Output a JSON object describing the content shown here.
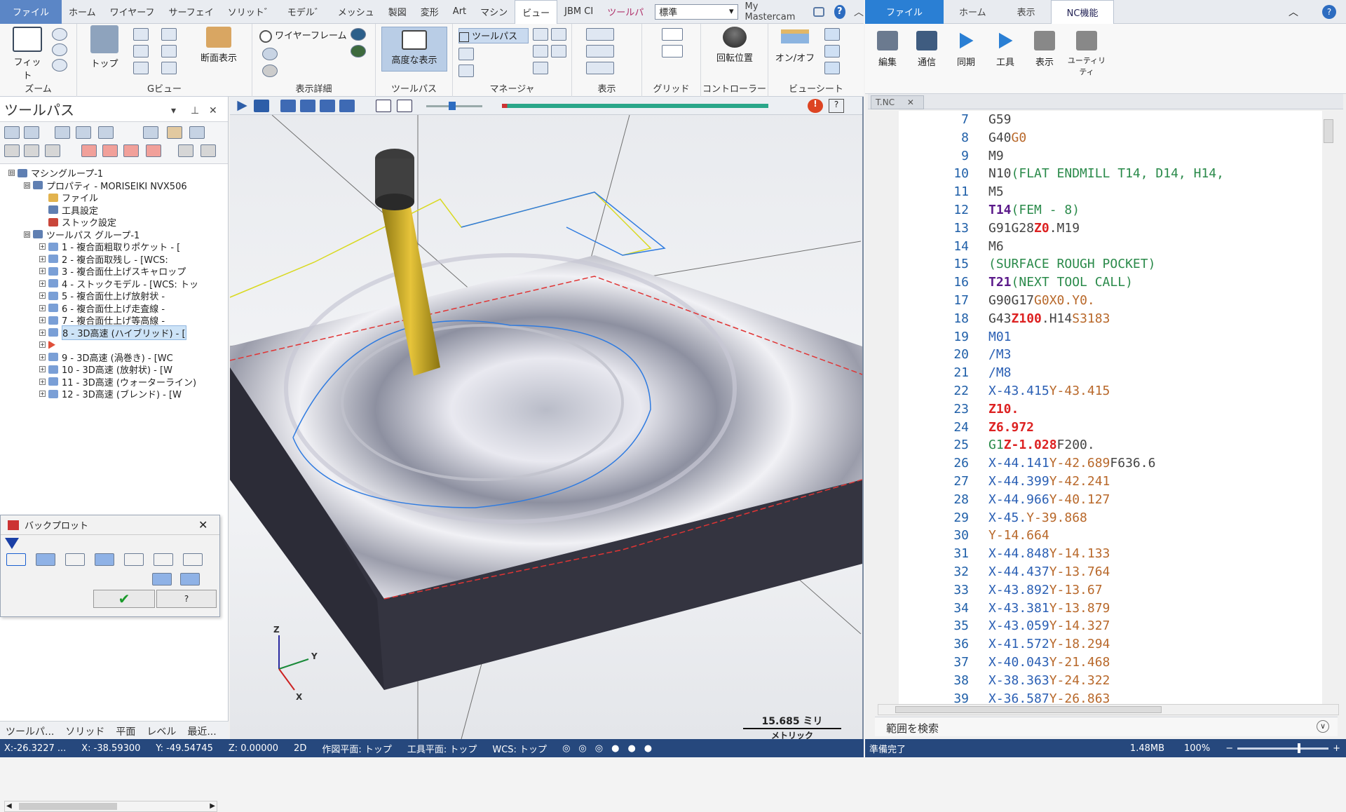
{
  "mastercam": {
    "tabs": [
      "ファイル",
      "ホーム",
      "ワイヤーフ",
      "サーフェイ",
      "ソリット゛",
      "モデル゛",
      "メッシュ",
      "製図",
      "変形",
      "Art",
      "マシン",
      "ビュー",
      "JBM CI",
      "ツールパ"
    ],
    "style_select": "標準",
    "my_mastercam": "My Mastercam",
    "ribbon": {
      "fit": "フィット",
      "zoom_group": "ズーム",
      "top": "トップ",
      "gview_group": "Gビュー",
      "section": "断面表示",
      "wireframe": "ワイヤーフレーム",
      "display_detail_group": "表示詳細",
      "advanced": "高度な表示",
      "toolpath_group": "ツールパス",
      "toolpath_btn": "ツールパス",
      "manager_group": "マネージャ",
      "display_group": "表示",
      "grid_group": "グリッド",
      "rotation": "回転位置",
      "controller_group": "コントローラー",
      "onoff": "オン/オフ",
      "viewsheet_group": "ビューシート"
    },
    "toolpath_panel": {
      "title": "ツールパス",
      "tree": [
        {
          "label": "マシングループ-1",
          "level": 0
        },
        {
          "label": "プロパティ - MORISEIKI NVX506",
          "level": 1
        },
        {
          "label": "ファイル",
          "level": 2
        },
        {
          "label": "工具設定",
          "level": 2
        },
        {
          "label": "ストック設定",
          "level": 2
        },
        {
          "label": "ツールパス グループ-1",
          "level": 1
        },
        {
          "label": "1 - 複合面粗取りポケット - [",
          "level": 2
        },
        {
          "label": "2 - 複合面取残し - [WCS:",
          "level": 2
        },
        {
          "label": "3 - 複合面仕上げスキャロップ",
          "level": 2
        },
        {
          "label": "4 - ストックモデル - [WCS: トッ",
          "level": 2
        },
        {
          "label": "5 - 複合面仕上げ放射状 -",
          "level": 2
        },
        {
          "label": "6 - 複合面仕上げ走査線 -",
          "level": 2
        },
        {
          "label": "7 - 複合面仕上げ等高線 -",
          "level": 2
        },
        {
          "label": "8 - 3D高速 (ハイブリッド) - [",
          "level": 2,
          "selected": true
        },
        {
          "label": "",
          "level": 2,
          "marker": true
        },
        {
          "label": "9 - 3D高速 (渦巻き) - [WC",
          "level": 2
        },
        {
          "label": "10 - 3D高速 (放射状) - [W",
          "level": 2
        },
        {
          "label": "11 - 3D高速 (ウォーターライン)",
          "level": 2
        },
        {
          "label": "12 - 3D高速 (ブレンド) - [W",
          "level": 2
        }
      ],
      "bottom_tabs": [
        "ツールパ...",
        "ソリッド",
        "平面",
        "レベル",
        "最近..."
      ]
    },
    "backplot_title": "バックプロット",
    "scale_value": "15.685 ミリ",
    "scale_unit": "メトリック",
    "axes": {
      "x": "X",
      "y": "Y",
      "z": "Z"
    },
    "status": {
      "coord": "X:-26.3227 ...",
      "x": "X: -38.59300",
      "y": "Y: -49.54745",
      "z": "Z: 0.00000",
      "mode": "2D",
      "cplane": "作図平面: トップ",
      "tplane": "工具平面: トップ",
      "wcs": "WCS: トップ"
    }
  },
  "nc_editor": {
    "tabs": [
      "ファイル",
      "ホーム",
      "表示",
      "NC機能"
    ],
    "buttons": [
      "編集",
      "通信",
      "同期",
      "工具",
      "表示",
      "ユーティリティ"
    ],
    "file_tab": "T.NC",
    "search_placeholder": "範囲を検索",
    "status_left": "準備完了",
    "status_size": "1.48MB",
    "status_zoom": "100%",
    "lines": [
      {
        "n": "7",
        "segs": [
          [
            "G59",
            "g"
          ]
        ]
      },
      {
        "n": "8",
        "segs": [
          [
            "G40",
            "g"
          ],
          [
            "G0",
            "ora"
          ]
        ]
      },
      {
        "n": "9",
        "segs": [
          [
            "M9",
            "g"
          ]
        ]
      },
      {
        "n": "10",
        "segs": [
          [
            "N10",
            "g"
          ],
          [
            "(FLAT ENDMILL T14, D14, H14,",
            "green"
          ]
        ]
      },
      {
        "n": "11",
        "segs": [
          [
            "M5",
            "g"
          ]
        ]
      },
      {
        "n": "12",
        "segs": [
          [
            "T14",
            "pur"
          ],
          [
            "(FEM - 8)",
            "green"
          ]
        ]
      },
      {
        "n": "13",
        "segs": [
          [
            "G91G28",
            "g"
          ],
          [
            "Z0",
            "red"
          ],
          [
            ".M19",
            "g"
          ]
        ]
      },
      {
        "n": "14",
        "segs": [
          [
            "M6",
            "g"
          ]
        ]
      },
      {
        "n": "15",
        "segs": [
          [
            "(SURFACE ROUGH POCKET)",
            "green"
          ]
        ]
      },
      {
        "n": "16",
        "segs": [
          [
            "T21",
            "pur"
          ],
          [
            "(NEXT TOOL CALL)",
            "green"
          ]
        ]
      },
      {
        "n": "17",
        "segs": [
          [
            "G90G17",
            "g"
          ],
          [
            "G0",
            "ora"
          ],
          [
            "X0.Y0.",
            "ora"
          ]
        ]
      },
      {
        "n": "18",
        "segs": [
          [
            "G43",
            "g"
          ],
          [
            "Z100",
            "red"
          ],
          [
            ".H14",
            "g"
          ],
          [
            "S3183",
            "ora"
          ]
        ]
      },
      {
        "n": "19",
        "segs": [
          [
            "M01",
            "blue"
          ]
        ]
      },
      {
        "n": "20",
        "segs": [
          [
            "/M3",
            "blue"
          ]
        ]
      },
      {
        "n": "21",
        "segs": [
          [
            "/M8",
            "blue"
          ]
        ]
      },
      {
        "n": "22",
        "segs": [
          [
            "X-43.415",
            "blue"
          ],
          [
            "Y-43.415",
            "ora"
          ]
        ]
      },
      {
        "n": "23",
        "segs": [
          [
            "Z10.",
            "red"
          ]
        ]
      },
      {
        "n": "24",
        "segs": [
          [
            "Z6.972",
            "red"
          ]
        ]
      },
      {
        "n": "25",
        "segs": [
          [
            "G1",
            "green"
          ],
          [
            "Z-1.028",
            "red"
          ],
          [
            "F200.",
            "g"
          ]
        ]
      },
      {
        "n": "26",
        "segs": [
          [
            "X-44.141",
            "blue"
          ],
          [
            "Y-42.689",
            "ora"
          ],
          [
            "F636.6",
            "g"
          ]
        ]
      },
      {
        "n": "27",
        "segs": [
          [
            "X-44.399",
            "blue"
          ],
          [
            "Y-42.241",
            "ora"
          ]
        ]
      },
      {
        "n": "28",
        "segs": [
          [
            "X-44.966",
            "blue"
          ],
          [
            "Y-40.127",
            "ora"
          ]
        ]
      },
      {
        "n": "29",
        "segs": [
          [
            "X-45.",
            "blue"
          ],
          [
            "Y-39.868",
            "ora"
          ]
        ]
      },
      {
        "n": "30",
        "segs": [
          [
            "Y-14.664",
            "ora"
          ]
        ]
      },
      {
        "n": "31",
        "segs": [
          [
            "X-44.848",
            "blue"
          ],
          [
            "Y-14.133",
            "ora"
          ]
        ]
      },
      {
        "n": "32",
        "segs": [
          [
            "X-44.437",
            "blue"
          ],
          [
            "Y-13.764",
            "ora"
          ]
        ]
      },
      {
        "n": "33",
        "segs": [
          [
            "X-43.892",
            "blue"
          ],
          [
            "Y-13.67",
            "ora"
          ]
        ]
      },
      {
        "n": "34",
        "segs": [
          [
            "X-43.381",
            "blue"
          ],
          [
            "Y-13.879",
            "ora"
          ]
        ]
      },
      {
        "n": "35",
        "segs": [
          [
            "X-43.059",
            "blue"
          ],
          [
            "Y-14.327",
            "ora"
          ]
        ]
      },
      {
        "n": "36",
        "segs": [
          [
            "X-41.572",
            "blue"
          ],
          [
            "Y-18.294",
            "ora"
          ]
        ]
      },
      {
        "n": "37",
        "segs": [
          [
            "X-40.043",
            "blue"
          ],
          [
            "Y-21.468",
            "ora"
          ]
        ]
      },
      {
        "n": "38",
        "segs": [
          [
            "X-38.363",
            "blue"
          ],
          [
            "Y-24.322",
            "ora"
          ]
        ]
      },
      {
        "n": "39",
        "segs": [
          [
            "X-36.587",
            "blue"
          ],
          [
            "Y-26.863",
            "ora"
          ]
        ]
      }
    ]
  }
}
